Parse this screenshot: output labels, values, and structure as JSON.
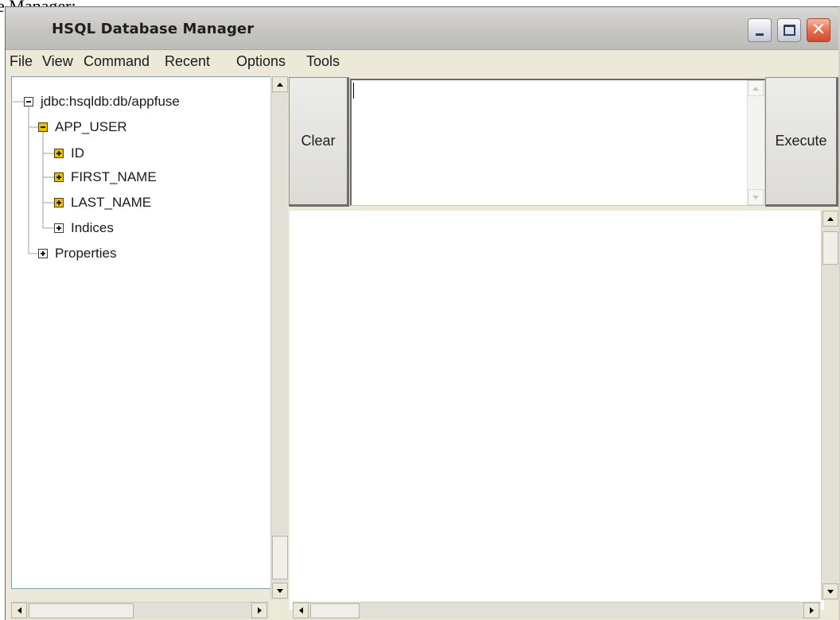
{
  "caption_fragment": "e Manager:",
  "window": {
    "title": "HSQL Database Manager"
  },
  "menu": [
    "File",
    "View",
    "Command",
    "Recent",
    "Options",
    "Tools"
  ],
  "tree": {
    "root": "jdbc:hsqldb:db/appfuse",
    "table": "APP_USER",
    "columns": [
      "ID",
      "FIRST_NAME",
      "LAST_NAME"
    ],
    "indices": "Indices",
    "properties": "Properties"
  },
  "buttons": {
    "clear": "Clear",
    "execute": "Execute"
  },
  "sql_input": {
    "value": ""
  },
  "colors": {
    "window_face": "#ece9d8",
    "expand_icon_yellow": "#e8c200",
    "close_button": "#d14a2e"
  }
}
